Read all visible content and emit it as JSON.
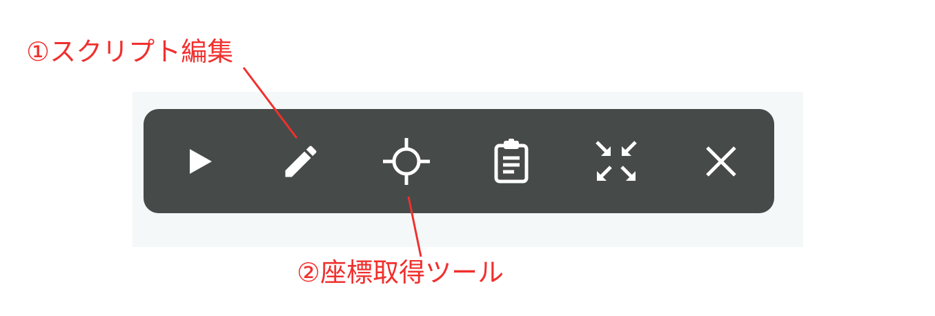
{
  "annotations": {
    "script_edit": "①スクリプト編集",
    "coordinate_tool": "②座標取得ツール"
  },
  "toolbar": {
    "buttons": [
      {
        "id": "play",
        "icon": "play-icon"
      },
      {
        "id": "edit",
        "icon": "pencil-icon"
      },
      {
        "id": "coordinate",
        "icon": "crosshair-icon"
      },
      {
        "id": "clipboard",
        "icon": "clipboard-icon"
      },
      {
        "id": "minimize",
        "icon": "collapse-arrows-icon"
      },
      {
        "id": "close",
        "icon": "close-icon"
      }
    ]
  },
  "colors": {
    "toolbar_background": "#464a49",
    "panel_background": "#f4f8f8",
    "icon": "#ffffff",
    "annotation": "#f0302e"
  }
}
